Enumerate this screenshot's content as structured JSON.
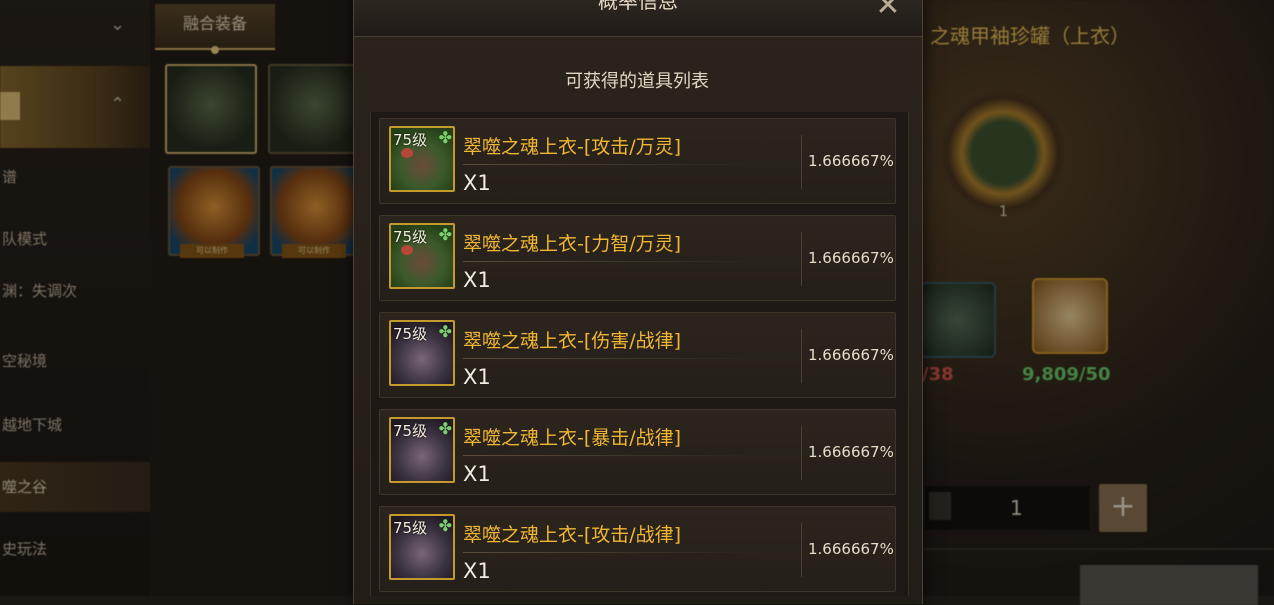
{
  "background": {
    "sidebar_items": [
      "谱",
      "队模式",
      "渊：失调次",
      "空秘境",
      "越地下城",
      "噬之谷",
      "史玩法"
    ],
    "fusion_tab_label": "融合装备",
    "thumb_label": "可以制作",
    "craft_title": "之魂甲袖珍罐（上衣）",
    "ring_count": "1",
    "material_a_count": "/38",
    "material_b_count": "9,809/50",
    "stepper_value": "1",
    "plus_label": "+"
  },
  "modal": {
    "title": "概率信息",
    "close_label": "✕",
    "subtitle": "可获得的道具列表",
    "items": [
      {
        "level": "75级",
        "name": "翠噬之魂上衣-[攻击/万灵]",
        "qty": "X1",
        "pct": "1.666667%",
        "icon": "green-armor-icon"
      },
      {
        "level": "75级",
        "name": "翠噬之魂上衣-[力智/万灵]",
        "qty": "X1",
        "pct": "1.666667%",
        "icon": "green-armor-icon"
      },
      {
        "level": "75级",
        "name": "翠噬之魂上衣-[伤害/战律]",
        "qty": "X1",
        "pct": "1.666667%",
        "icon": "dark-armor-icon"
      },
      {
        "level": "75级",
        "name": "翠噬之魂上衣-[暴击/战律]",
        "qty": "X1",
        "pct": "1.666667%",
        "icon": "dark-armor-icon"
      },
      {
        "level": "75级",
        "name": "翠噬之魂上衣-[攻击/战律]",
        "qty": "X1",
        "pct": "1.666667%",
        "icon": "dark-armor-icon"
      }
    ]
  }
}
